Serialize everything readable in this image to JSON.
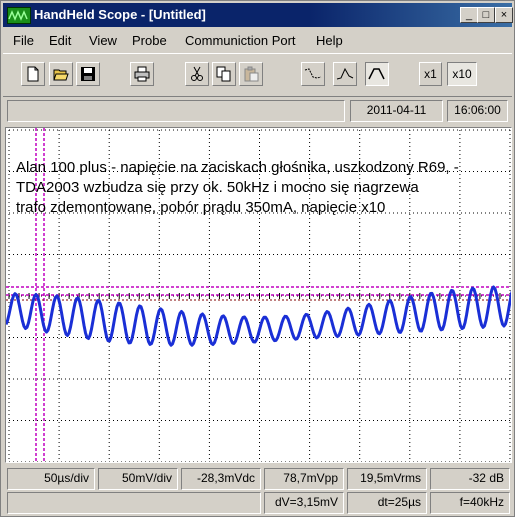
{
  "window": {
    "title": "HandHeld Scope - [Untitled]"
  },
  "title_buttons": {
    "minimize": "_",
    "maximize": "□",
    "close": "×"
  },
  "menu": [
    "File",
    "Edit",
    "View",
    "Probe",
    "Communiction Port",
    "Help"
  ],
  "toolbar": {
    "icons": [
      "new-file-icon",
      "open-folder-icon",
      "save-disk-icon",
      "print-icon",
      "cut-icon",
      "copy-icon",
      "paste-icon",
      "trigger-falling-icon",
      "trigger-rising-icon",
      "trigger-auto-icon"
    ],
    "probe_x1": "x1",
    "probe_x10": "x10"
  },
  "status_top": {
    "message": "",
    "date": "2011-04-11",
    "time": "16:06:00"
  },
  "note_lines": [
    "Alan 100 plus - napięcie na zaciskach głośnika, uszkodzony R69, -",
    "TDA2003 wzbudza się przy ok. 50kHz i mocno się nagrzewa",
    "trafo zdemontowane, pobór prądu 350mA, napięcie x10"
  ],
  "status_bottom": {
    "timebase": "50µs/div",
    "volts_div": "50mV/div",
    "vdc": "-28,3mVdc",
    "vpp": "78,7mVpp",
    "vrms": "19,5mVrms",
    "db": "-32 dB"
  },
  "status_cursors": {
    "dv": "dV=3,15mV",
    "dt": "dt=25µs",
    "freq": "f=40kHz"
  },
  "colors": {
    "trace": "#1a2fd6",
    "grid": "#000000",
    "cursor": "#c000c0",
    "title_bar": "#0a246a"
  }
}
